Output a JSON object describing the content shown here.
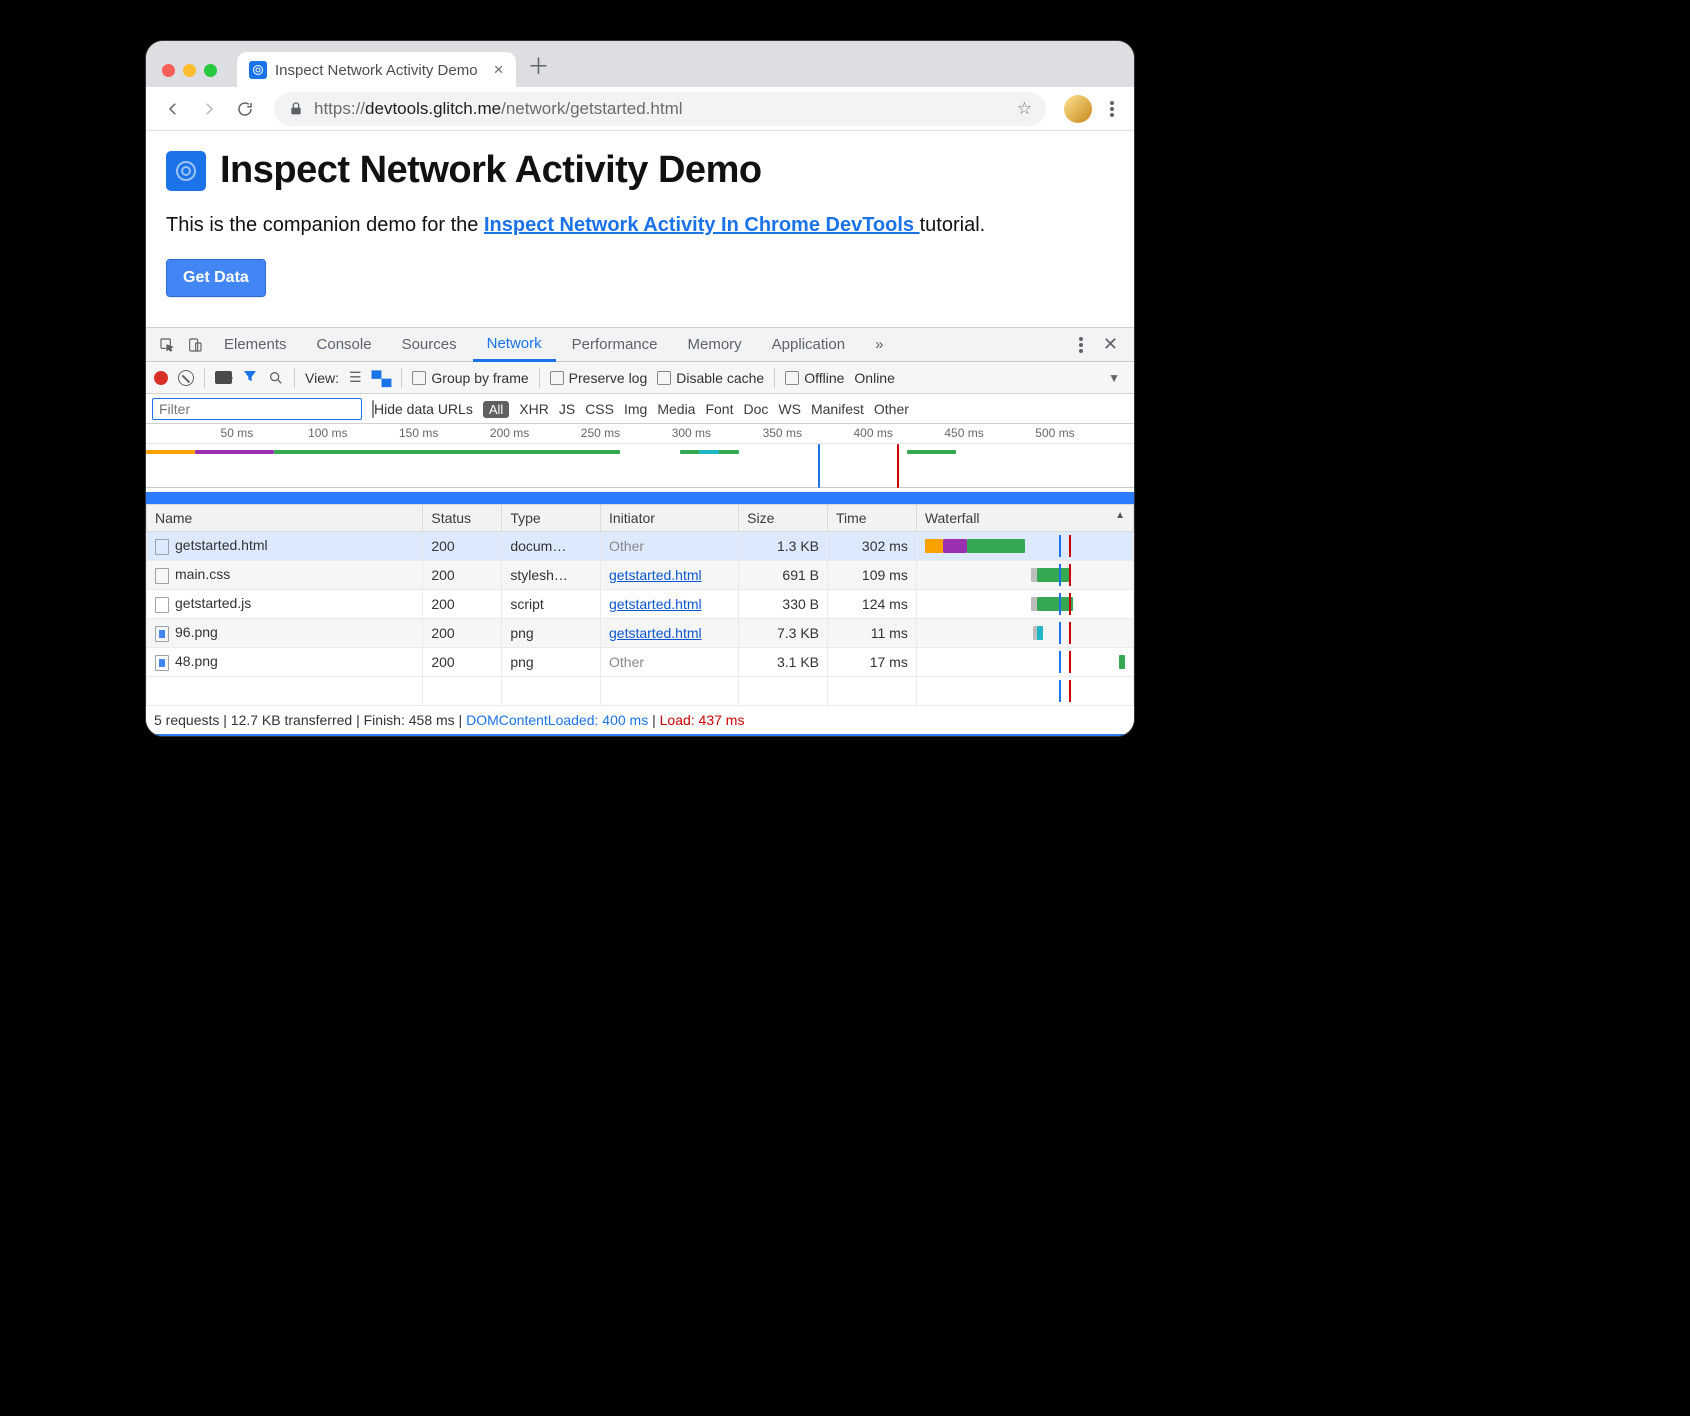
{
  "browser": {
    "tab_title": "Inspect Network Activity Demo",
    "url_host": "devtools.glitch.me",
    "url_path": "/network/getstarted.html",
    "url_scheme": "https://"
  },
  "page": {
    "heading": "Inspect Network Activity Demo",
    "intro_pre": "This is the companion demo for the ",
    "intro_link": "Inspect Network Activity In Chrome DevTools ",
    "intro_post": "tutorial.",
    "button": "Get Data"
  },
  "devtools": {
    "tabs": [
      "Elements",
      "Console",
      "Sources",
      "Network",
      "Performance",
      "Memory",
      "Application"
    ],
    "active_tab": "Network",
    "net_toolbar": {
      "view_label": "View:",
      "group_by_frame": "Group by frame",
      "preserve_log": "Preserve log",
      "disable_cache": "Disable cache",
      "offline": "Offline",
      "online": "Online"
    },
    "filter": {
      "placeholder": "Filter",
      "hide_data_urls": "Hide data URLs",
      "types": [
        "All",
        "XHR",
        "JS",
        "CSS",
        "Img",
        "Media",
        "Font",
        "Doc",
        "WS",
        "Manifest",
        "Other"
      ]
    },
    "ruler_ticks": [
      "50 ms",
      "100 ms",
      "150 ms",
      "200 ms",
      "250 ms",
      "300 ms",
      "350 ms",
      "400 ms",
      "450 ms",
      "500 ms"
    ],
    "columns": [
      "Name",
      "Status",
      "Type",
      "Initiator",
      "Size",
      "Time",
      "Waterfall"
    ],
    "rows": [
      {
        "name": "getstarted.html",
        "status": "200",
        "type": "docum…",
        "initiator": "Other",
        "initiator_link": false,
        "size": "1.3 KB",
        "time": "302 ms",
        "icon": "doc",
        "sel": true,
        "wf": [
          {
            "l": 0,
            "w": 9,
            "c": "#f8a100"
          },
          {
            "l": 9,
            "w": 12,
            "c": "#9b30b0"
          },
          {
            "l": 21,
            "w": 29,
            "c": "#34a853"
          }
        ]
      },
      {
        "name": "main.css",
        "status": "200",
        "type": "stylesh…",
        "initiator": "getstarted.html",
        "initiator_link": true,
        "size": "691 B",
        "time": "109 ms",
        "icon": "doc",
        "sel": false,
        "wf": [
          {
            "l": 53,
            "w": 3,
            "c": "#bdbdbd"
          },
          {
            "l": 56,
            "w": 16,
            "c": "#34a853"
          }
        ]
      },
      {
        "name": "getstarted.js",
        "status": "200",
        "type": "script",
        "initiator": "getstarted.html",
        "initiator_link": true,
        "size": "330 B",
        "time": "124 ms",
        "icon": "doc",
        "sel": false,
        "wf": [
          {
            "l": 53,
            "w": 3,
            "c": "#bdbdbd"
          },
          {
            "l": 56,
            "w": 18,
            "c": "#34a853"
          }
        ]
      },
      {
        "name": "96.png",
        "status": "200",
        "type": "png",
        "initiator": "getstarted.html",
        "initiator_link": true,
        "size": "7.3 KB",
        "time": "11 ms",
        "icon": "img",
        "sel": false,
        "wf": [
          {
            "l": 54,
            "w": 2,
            "c": "#bdbdbd"
          },
          {
            "l": 56,
            "w": 3,
            "c": "#1fb6c5"
          }
        ]
      },
      {
        "name": "48.png",
        "status": "200",
        "type": "png",
        "initiator": "Other",
        "initiator_link": false,
        "size": "3.1 KB",
        "time": "17 ms",
        "icon": "img",
        "sel": false,
        "wf": [
          {
            "l": 97,
            "w": 3,
            "c": "#34a853"
          }
        ]
      }
    ],
    "markers": {
      "domcontent_pct": 67,
      "load_pct": 72
    },
    "status_bar": {
      "requests": "5 requests",
      "transferred": "12.7 KB transferred",
      "finish": "Finish: 458 ms",
      "dcl": "DOMContentLoaded: 400 ms",
      "load": "Load: 437 ms"
    }
  },
  "colors": {
    "orange": "#f8a100",
    "purple": "#9b30b0",
    "green": "#34a853",
    "teal": "#1fb6c5",
    "blue_line": "#1a73e8",
    "red_line": "#cc0000"
  }
}
